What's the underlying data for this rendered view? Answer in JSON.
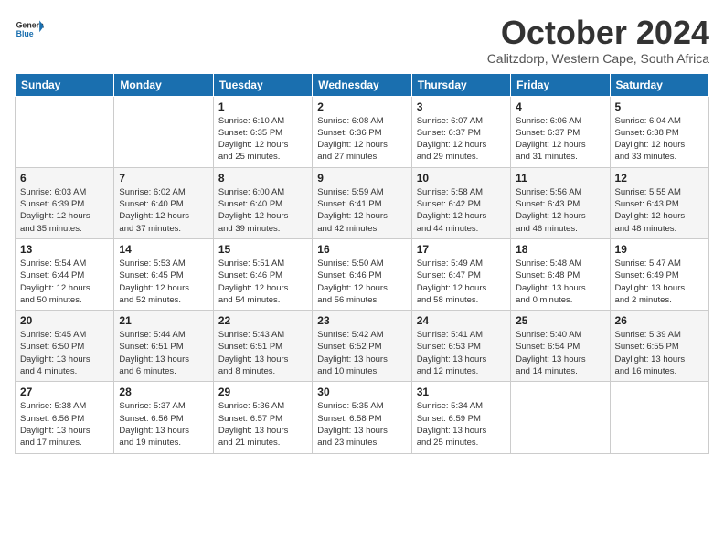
{
  "header": {
    "logo": {
      "general": "General",
      "blue": "Blue"
    },
    "title": "October 2024",
    "location": "Calitzdorp, Western Cape, South Africa"
  },
  "days_of_week": [
    "Sunday",
    "Monday",
    "Tuesday",
    "Wednesday",
    "Thursday",
    "Friday",
    "Saturday"
  ],
  "weeks": [
    [
      {
        "day": "",
        "info": ""
      },
      {
        "day": "",
        "info": ""
      },
      {
        "day": "1",
        "info": "Sunrise: 6:10 AM\nSunset: 6:35 PM\nDaylight: 12 hours\nand 25 minutes."
      },
      {
        "day": "2",
        "info": "Sunrise: 6:08 AM\nSunset: 6:36 PM\nDaylight: 12 hours\nand 27 minutes."
      },
      {
        "day": "3",
        "info": "Sunrise: 6:07 AM\nSunset: 6:37 PM\nDaylight: 12 hours\nand 29 minutes."
      },
      {
        "day": "4",
        "info": "Sunrise: 6:06 AM\nSunset: 6:37 PM\nDaylight: 12 hours\nand 31 minutes."
      },
      {
        "day": "5",
        "info": "Sunrise: 6:04 AM\nSunset: 6:38 PM\nDaylight: 12 hours\nand 33 minutes."
      }
    ],
    [
      {
        "day": "6",
        "info": "Sunrise: 6:03 AM\nSunset: 6:39 PM\nDaylight: 12 hours\nand 35 minutes."
      },
      {
        "day": "7",
        "info": "Sunrise: 6:02 AM\nSunset: 6:40 PM\nDaylight: 12 hours\nand 37 minutes."
      },
      {
        "day": "8",
        "info": "Sunrise: 6:00 AM\nSunset: 6:40 PM\nDaylight: 12 hours\nand 39 minutes."
      },
      {
        "day": "9",
        "info": "Sunrise: 5:59 AM\nSunset: 6:41 PM\nDaylight: 12 hours\nand 42 minutes."
      },
      {
        "day": "10",
        "info": "Sunrise: 5:58 AM\nSunset: 6:42 PM\nDaylight: 12 hours\nand 44 minutes."
      },
      {
        "day": "11",
        "info": "Sunrise: 5:56 AM\nSunset: 6:43 PM\nDaylight: 12 hours\nand 46 minutes."
      },
      {
        "day": "12",
        "info": "Sunrise: 5:55 AM\nSunset: 6:43 PM\nDaylight: 12 hours\nand 48 minutes."
      }
    ],
    [
      {
        "day": "13",
        "info": "Sunrise: 5:54 AM\nSunset: 6:44 PM\nDaylight: 12 hours\nand 50 minutes."
      },
      {
        "day": "14",
        "info": "Sunrise: 5:53 AM\nSunset: 6:45 PM\nDaylight: 12 hours\nand 52 minutes."
      },
      {
        "day": "15",
        "info": "Sunrise: 5:51 AM\nSunset: 6:46 PM\nDaylight: 12 hours\nand 54 minutes."
      },
      {
        "day": "16",
        "info": "Sunrise: 5:50 AM\nSunset: 6:46 PM\nDaylight: 12 hours\nand 56 minutes."
      },
      {
        "day": "17",
        "info": "Sunrise: 5:49 AM\nSunset: 6:47 PM\nDaylight: 12 hours\nand 58 minutes."
      },
      {
        "day": "18",
        "info": "Sunrise: 5:48 AM\nSunset: 6:48 PM\nDaylight: 13 hours\nand 0 minutes."
      },
      {
        "day": "19",
        "info": "Sunrise: 5:47 AM\nSunset: 6:49 PM\nDaylight: 13 hours\nand 2 minutes."
      }
    ],
    [
      {
        "day": "20",
        "info": "Sunrise: 5:45 AM\nSunset: 6:50 PM\nDaylight: 13 hours\nand 4 minutes."
      },
      {
        "day": "21",
        "info": "Sunrise: 5:44 AM\nSunset: 6:51 PM\nDaylight: 13 hours\nand 6 minutes."
      },
      {
        "day": "22",
        "info": "Sunrise: 5:43 AM\nSunset: 6:51 PM\nDaylight: 13 hours\nand 8 minutes."
      },
      {
        "day": "23",
        "info": "Sunrise: 5:42 AM\nSunset: 6:52 PM\nDaylight: 13 hours\nand 10 minutes."
      },
      {
        "day": "24",
        "info": "Sunrise: 5:41 AM\nSunset: 6:53 PM\nDaylight: 13 hours\nand 12 minutes."
      },
      {
        "day": "25",
        "info": "Sunrise: 5:40 AM\nSunset: 6:54 PM\nDaylight: 13 hours\nand 14 minutes."
      },
      {
        "day": "26",
        "info": "Sunrise: 5:39 AM\nSunset: 6:55 PM\nDaylight: 13 hours\nand 16 minutes."
      }
    ],
    [
      {
        "day": "27",
        "info": "Sunrise: 5:38 AM\nSunset: 6:56 PM\nDaylight: 13 hours\nand 17 minutes."
      },
      {
        "day": "28",
        "info": "Sunrise: 5:37 AM\nSunset: 6:56 PM\nDaylight: 13 hours\nand 19 minutes."
      },
      {
        "day": "29",
        "info": "Sunrise: 5:36 AM\nSunset: 6:57 PM\nDaylight: 13 hours\nand 21 minutes."
      },
      {
        "day": "30",
        "info": "Sunrise: 5:35 AM\nSunset: 6:58 PM\nDaylight: 13 hours\nand 23 minutes."
      },
      {
        "day": "31",
        "info": "Sunrise: 5:34 AM\nSunset: 6:59 PM\nDaylight: 13 hours\nand 25 minutes."
      },
      {
        "day": "",
        "info": ""
      },
      {
        "day": "",
        "info": ""
      }
    ]
  ]
}
